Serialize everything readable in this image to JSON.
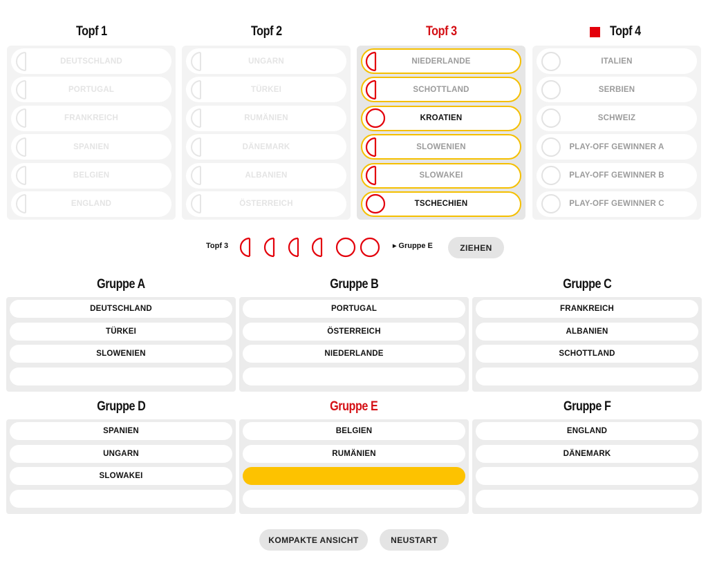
{
  "pots": [
    {
      "title": "Topf 1",
      "active": false,
      "marker": false,
      "teams": [
        {
          "name": "DEUTSCHLAND",
          "state": "faded",
          "ball": "half"
        },
        {
          "name": "PORTUGAL",
          "state": "faded",
          "ball": "half"
        },
        {
          "name": "FRANKREICH",
          "state": "faded",
          "ball": "half"
        },
        {
          "name": "SPANIEN",
          "state": "faded",
          "ball": "half"
        },
        {
          "name": "BELGIEN",
          "state": "faded",
          "ball": "half"
        },
        {
          "name": "ENGLAND",
          "state": "faded",
          "ball": "half"
        }
      ]
    },
    {
      "title": "Topf 2",
      "active": false,
      "marker": false,
      "teams": [
        {
          "name": "UNGARN",
          "state": "faded",
          "ball": "half"
        },
        {
          "name": "TÜRKEI",
          "state": "faded",
          "ball": "half"
        },
        {
          "name": "RUMÄNIEN",
          "state": "faded",
          "ball": "half"
        },
        {
          "name": "DÄNEMARK",
          "state": "faded",
          "ball": "half"
        },
        {
          "name": "ALBANIEN",
          "state": "faded",
          "ball": "half"
        },
        {
          "name": "ÖSTERREICH",
          "state": "faded",
          "ball": "half"
        }
      ]
    },
    {
      "title": "Topf 3",
      "active": true,
      "marker": false,
      "teams": [
        {
          "name": "NIEDERLANDE",
          "state": "muted",
          "ball": "half"
        },
        {
          "name": "SCHOTTLAND",
          "state": "muted",
          "ball": "half"
        },
        {
          "name": "KROATIEN",
          "state": "dark",
          "ball": "full"
        },
        {
          "name": "SLOWENIEN",
          "state": "muted",
          "ball": "half"
        },
        {
          "name": "SLOWAKEI",
          "state": "muted",
          "ball": "half"
        },
        {
          "name": "TSCHECHIEN",
          "state": "dark",
          "ball": "full"
        }
      ]
    },
    {
      "title": "Topf 4",
      "active": false,
      "marker": true,
      "teams": [
        {
          "name": "ITALIEN",
          "state": "muted",
          "ball": "grey"
        },
        {
          "name": "SERBIEN",
          "state": "muted",
          "ball": "grey"
        },
        {
          "name": "SCHWEIZ",
          "state": "muted",
          "ball": "grey"
        },
        {
          "name": "PLAY-OFF GEWINNER A",
          "state": "muted",
          "ball": "grey"
        },
        {
          "name": "PLAY-OFF GEWINNER B",
          "state": "muted",
          "ball": "grey"
        },
        {
          "name": "PLAY-OFF GEWINNER C",
          "state": "muted",
          "ball": "grey"
        }
      ]
    }
  ],
  "draw": {
    "pot_label": "Topf 3",
    "balls": [
      "half",
      "half",
      "half",
      "half",
      "full",
      "full"
    ],
    "target_label": "Gruppe E",
    "button_label": "ZIEHEN"
  },
  "groups": [
    {
      "title": "Gruppe A",
      "active": false,
      "slots": [
        "DEUTSCHLAND",
        "TÜRKEI",
        "SLOWENIEN",
        ""
      ]
    },
    {
      "title": "Gruppe B",
      "active": false,
      "slots": [
        "PORTUGAL",
        "ÖSTERREICH",
        "NIEDERLANDE",
        ""
      ]
    },
    {
      "title": "Gruppe C",
      "active": false,
      "slots": [
        "FRANKREICH",
        "ALBANIEN",
        "SCHOTTLAND",
        ""
      ]
    },
    {
      "title": "Gruppe D",
      "active": false,
      "slots": [
        "SPANIEN",
        "UNGARN",
        "SLOWAKEI",
        ""
      ]
    },
    {
      "title": "Gruppe E",
      "active": true,
      "slots": [
        "BELGIEN",
        "RUMÄNIEN",
        "",
        ""
      ],
      "highlight_slot": 2
    },
    {
      "title": "Gruppe F",
      "active": false,
      "slots": [
        "ENGLAND",
        "DÄNEMARK",
        "",
        ""
      ]
    }
  ],
  "buttons": {
    "compact_label": "KOMPAKTE ANSICHT",
    "restart_label": "NEUSTART"
  },
  "colors": {
    "accent_red": "#d40f14",
    "highlight_yellow": "#fdc200",
    "ball_red": "#e3000b"
  }
}
